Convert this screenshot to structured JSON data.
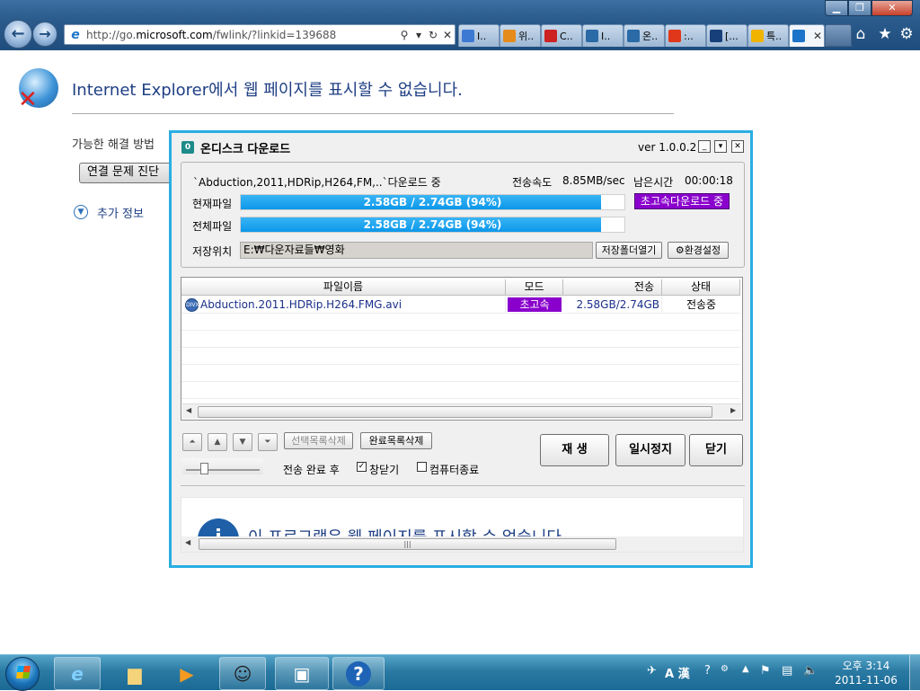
{
  "ie": {
    "address_url_prefix": "http://go.",
    "address_url_domain": "microsoft.com",
    "address_url_suffix": "/fwlink/?linkid=139688",
    "tabs": [
      {
        "label": "I..",
        "color": "#3c79d3"
      },
      {
        "label": "위..",
        "color": "#e58b1c"
      },
      {
        "label": "C..",
        "color": "#cc2222"
      },
      {
        "label": "I..",
        "color": "#2a6aa6"
      },
      {
        "label": "온..",
        "color": "#2a6aa6"
      },
      {
        "label": ":..",
        "color": "#e0371a"
      },
      {
        "label": "[...",
        "color": "#173f7a"
      },
      {
        "label": "특..",
        "color": "#f0b400"
      }
    ]
  },
  "error_page": {
    "title": "Internet Explorer에서 웹 페이지를 표시할 수 없습니다.",
    "possible_fix": "가능한 해결 방법",
    "diagnose_button": "연결 문제 진단",
    "more_info": "추가 정보"
  },
  "ondisk": {
    "title": "온디스크 다운로드",
    "version": "ver 1.0.0.2",
    "download_status": "`Abduction,2011,HDRip,H264,FM,..`다운로드 중",
    "speed_label": "전송속도",
    "speed_value": "8.85MB/sec",
    "remain_label": "남은시간",
    "remain_value": "00:00:18",
    "current_label": "현재파일",
    "total_label": "전체파일",
    "current_progress_text": "2.58GB / 2.74GB (94%)",
    "total_progress_text": "2.58GB / 2.74GB (94%)",
    "progress_fraction": 0.94,
    "turbo_status": "초고속다운로드 중",
    "save_label": "저장위치",
    "save_path": "E:₩다운자료들₩영화",
    "open_folder_button": "저장폴더열기",
    "settings_button": "환경설정",
    "columns": [
      "파일이름",
      "모드",
      "전송",
      "상태"
    ],
    "files": [
      {
        "name": "Abduction.2011.HDRip.H264.FMG.avi",
        "mode": "초고속",
        "transfer": "2.58GB/2.74GB",
        "status": "전송중"
      }
    ],
    "delete_selected_button": "선택목록삭제",
    "delete_done_button": "완료목록삭제",
    "play_button": "재 생",
    "pause_button": "일시정지",
    "close_button": "닫기",
    "after_label": "전송 완료 후",
    "close_window_label": "창닫기",
    "shutdown_label": "컴퓨터종료",
    "embedded_text": "이 프로그램은 웹 페이지를 표시할 수 없습니다"
  },
  "accent_color": "#29aee2",
  "badge_color": "#8a00cc",
  "tray": {
    "ime": "A 漢",
    "time": "오후 3:14",
    "date": "2011-11-06"
  }
}
